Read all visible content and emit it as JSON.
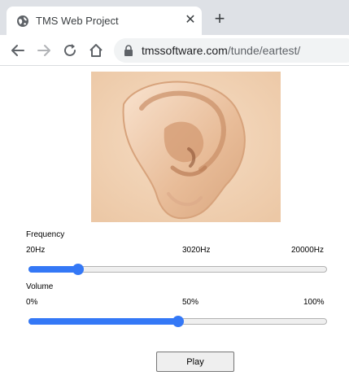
{
  "browser": {
    "tab_title": "TMS Web Project",
    "url_host": "tmssoftware.com",
    "url_path": "/tunde/eartest/"
  },
  "frequency": {
    "label": "Frequency",
    "min_label": "20Hz",
    "mid_label": "3020Hz",
    "max_label": "20000Hz",
    "value": 0.165
  },
  "volume": {
    "label": "Volume",
    "min_label": "0%",
    "mid_label": "50%",
    "max_label": "100%",
    "value": 0.5
  },
  "play_label": "Play",
  "colors": {
    "accent": "#3478f6",
    "skin": "#f1d4b7"
  },
  "icons": {
    "favicon": "globe-icon",
    "close": "close-icon",
    "new_tab": "plus-icon",
    "back": "arrow-left-icon",
    "forward": "arrow-right-icon",
    "reload": "reload-icon",
    "home": "home-icon",
    "lock": "lock-icon"
  }
}
